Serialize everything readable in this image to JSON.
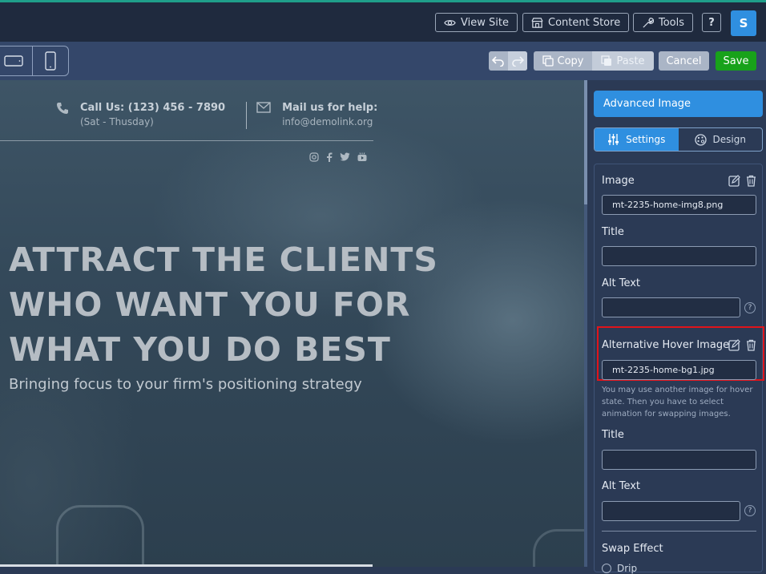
{
  "topbar": {
    "view_site": "View Site",
    "content_store": "Content Store",
    "tools": "Tools",
    "help": "?",
    "avatar_letter": "S"
  },
  "toolbar": {
    "copy": "Copy",
    "paste": "Paste",
    "cancel": "Cancel",
    "save": "Save"
  },
  "canvas": {
    "call_title": "Call Us: (123) 456 - 7890",
    "call_sub": "(Sat - Thusday)",
    "mail_title": "Mail us for help:",
    "mail_sub": "info@demolink.org",
    "headline_1": "ATTRACT THE CLIENTS",
    "headline_2": "WHO WANT YOU FOR",
    "headline_3": "WHAT YOU DO BEST",
    "subheadline": "Bringing focus to your firm's positioning strategy"
  },
  "panel": {
    "title": "Advanced Image",
    "tabs": [
      {
        "label": "Settings",
        "active": true
      },
      {
        "label": "Design",
        "active": false
      }
    ],
    "image_label": "Image",
    "image_value": "mt-2235-home-img8.png",
    "title_label": "Title",
    "alt_label": "Alt Text",
    "hover_label": "Alternative Hover Image",
    "hover_value": "mt-2235-home-bg1.jpg",
    "hover_help": "You may use another image for hover state. Then you have to select animation for swapping images.",
    "title2_label": "Title",
    "alt2_label": "Alt Text",
    "swap_label": "Swap Effect",
    "swap_option_peek": "Drip"
  },
  "colors": {
    "accent": "#2f8fe0",
    "save_green": "#18a21a",
    "highlight_red": "#e0141b"
  }
}
